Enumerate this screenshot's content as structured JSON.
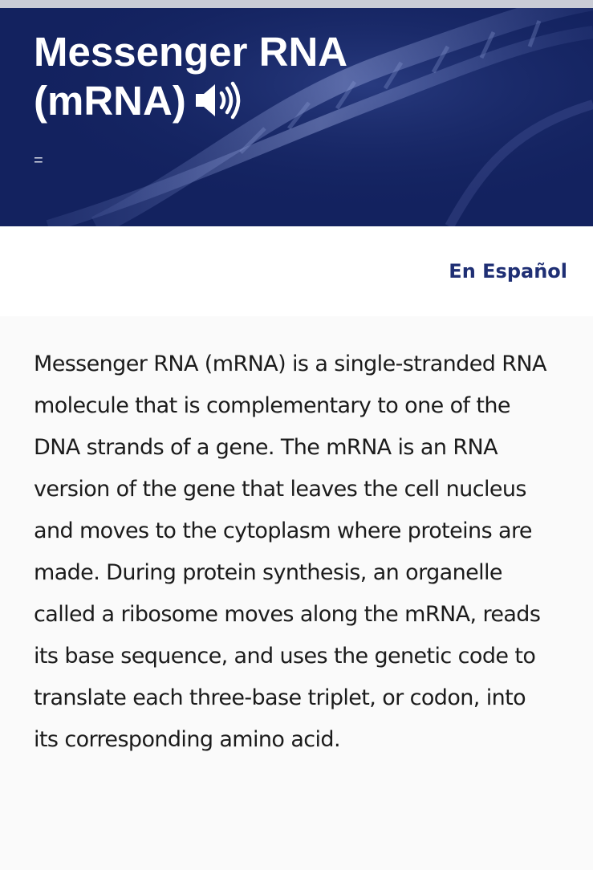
{
  "header": {
    "title": "Messenger RNA (mRNA)",
    "speaker_icon": "speaker-volume-icon",
    "menu_glyph": "=",
    "background_color": "#13225f"
  },
  "language_link": {
    "label": "En Español",
    "color": "#1f2f74"
  },
  "definition": {
    "text": "Messenger RNA (mRNA) is a single-stranded RNA molecule that is complementary to one of the DNA strands of a gene. The mRNA is an RNA version of the gene that leaves the cell nucleus and moves to the cytoplasm where proteins are made. During protein synthesis, an organelle called a ribosome moves along the mRNA, reads its base sequence, and uses the genetic code to translate each three-base triplet, or codon, into its corresponding amino acid."
  }
}
